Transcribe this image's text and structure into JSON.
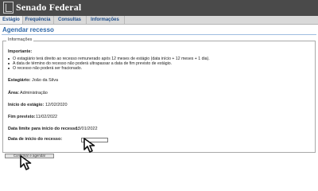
{
  "header": {
    "title": "Senado Federal"
  },
  "nav": {
    "items": [
      {
        "label": "Estágio",
        "active": true
      },
      {
        "label": "Frequência",
        "active": false
      },
      {
        "label": "Consultas",
        "active": false
      },
      {
        "label": "Informações",
        "active": false
      }
    ]
  },
  "page": {
    "title": "Agendar recesso"
  },
  "panel": {
    "legend": "Informações",
    "important_label": "Importante:",
    "notes": [
      "O estagiário terá direito ao recesso remunerado após 12 meses de estágio (data início + 12 meses + 1 dia).",
      "A data de término do recesso não poderá ultrapassar a data de fim previsto de estágio.",
      "O recesso não poderá ser fracionado."
    ],
    "fields": {
      "estagiario": {
        "label": "Estagiário:",
        "value": "João da Silva"
      },
      "area": {
        "label": "Área:",
        "value": "Administração"
      },
      "inicio": {
        "label": "Início do estágio:",
        "value": "12/02/2020"
      },
      "fim": {
        "label": "Fim previsto:",
        "value": "11/02/2022"
      },
      "limite": {
        "label": "Data limite para início do recesso:",
        "value": "13/01/2022"
      },
      "data_inicio_recesso": {
        "label": "Data de início do recesso:",
        "value": ""
      }
    }
  },
  "actions": {
    "submit_label": "Confirmar e agendar"
  },
  "icons": {
    "logo": "senado-logo-icon",
    "pointer": "arrow-cursor-icon"
  },
  "colors": {
    "header_bg": "#4a4a4a",
    "nav_bg": "#d9d9d9",
    "title_blue": "#2f68a8",
    "nav_text": "#1f4e8a"
  }
}
